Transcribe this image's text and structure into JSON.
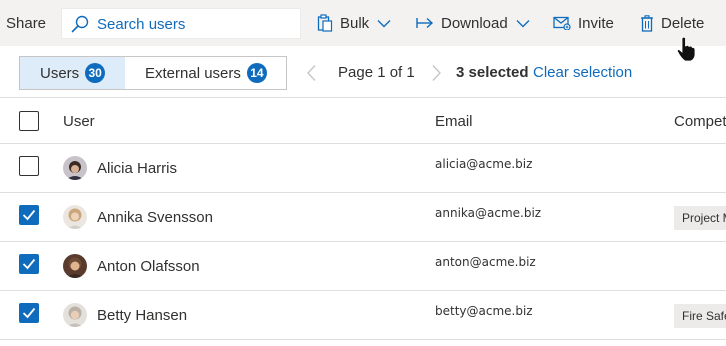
{
  "toolbar": {
    "share_label": "Share",
    "search_placeholder": "Search users",
    "bulk_label": "Bulk",
    "download_label": "Download",
    "invite_label": "Invite",
    "delete_label": "Delete"
  },
  "tabs": [
    {
      "label": "Users",
      "count": "30",
      "active": true
    },
    {
      "label": "External users",
      "count": "14",
      "active": false
    }
  ],
  "pager": {
    "label": "Page 1 of 1",
    "selected": "3 selected",
    "clear": "Clear selection"
  },
  "table": {
    "columns": [
      "User",
      "Email",
      "Compet"
    ],
    "rows": [
      {
        "name": "Alicia Harris",
        "email": "alicia@acme.biz",
        "tag": "",
        "checked": false
      },
      {
        "name": "Annika Svensson",
        "email": "annika@acme.biz",
        "tag": "Project M",
        "checked": true
      },
      {
        "name": "Anton Olafsson",
        "email": "anton@acme.biz",
        "tag": "",
        "checked": true
      },
      {
        "name": "Betty Hansen",
        "email": "betty@acme.biz",
        "tag": "Fire Safe",
        "checked": true
      }
    ]
  },
  "colors": {
    "accent": "#0f6cbd",
    "toolbar_bg": "#f3f2f1",
    "active_tab_bg": "#deecf9"
  }
}
